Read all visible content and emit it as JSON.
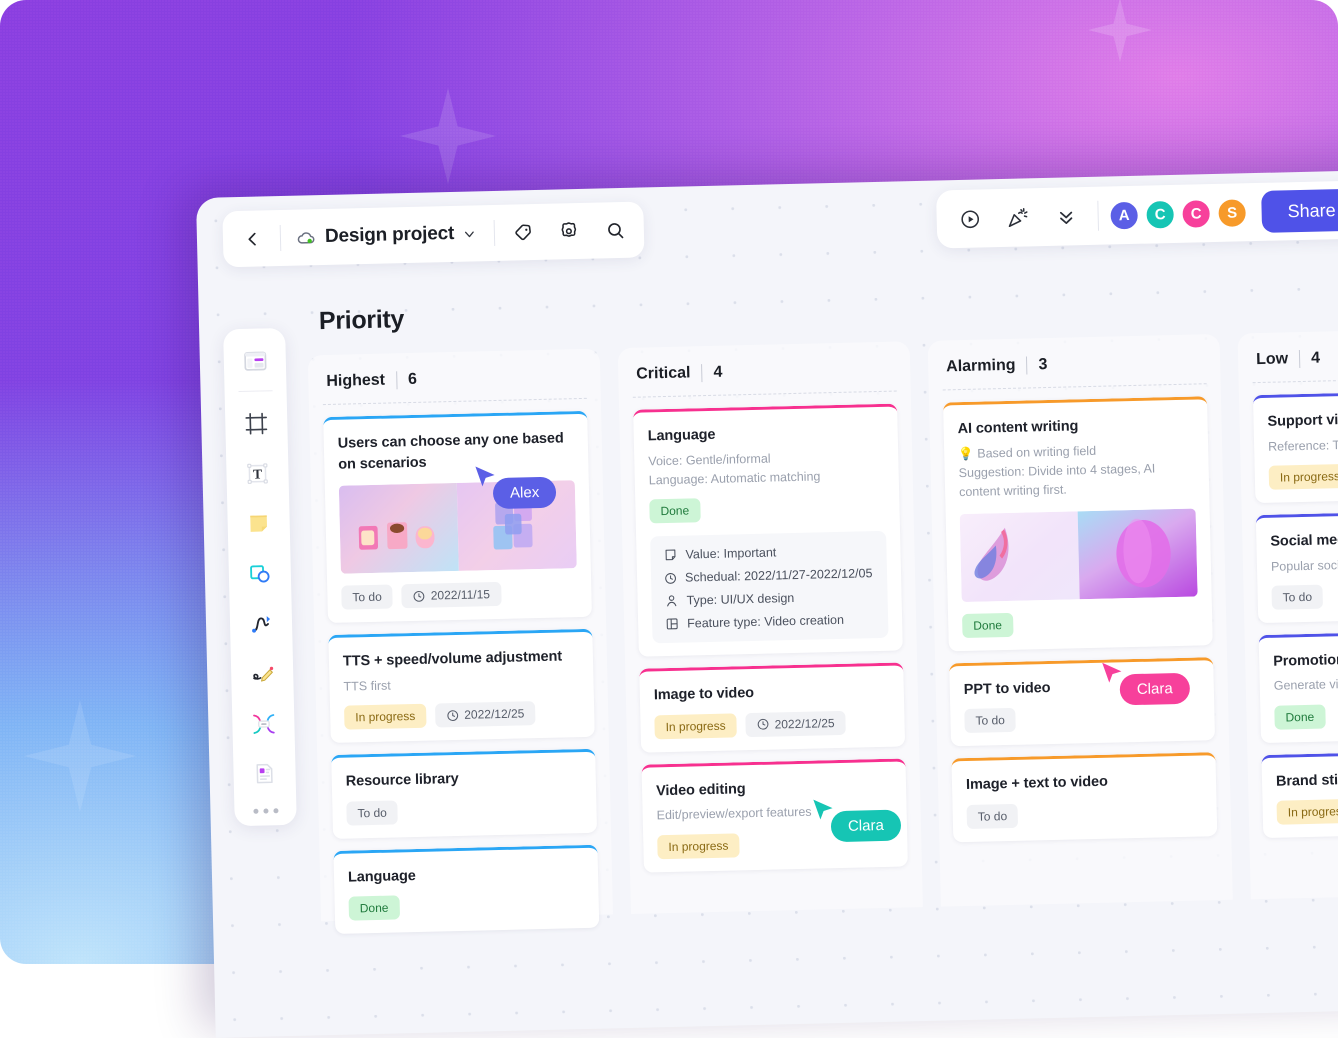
{
  "toolbar": {
    "back_icon": "chevron-left-icon",
    "project_icon": "cloud-status-icon",
    "project_name": "Design project",
    "dropdown_icon": "chevron-down-icon",
    "tag_icon": "tag-icon",
    "settings_icon": "gear-icon",
    "search_icon": "search-icon",
    "present_icon": "play-circle-icon",
    "celebrate_icon": "party-popper-icon",
    "collapse_icon": "double-chevron-down-icon",
    "share_label": "Share",
    "share_color": "#4f52e8",
    "avatars": [
      {
        "initial": "A",
        "color": "#5b5fe6"
      },
      {
        "initial": "C",
        "color": "#16c5b4"
      },
      {
        "initial": "C",
        "color": "#f7409b"
      },
      {
        "initial": "S",
        "color": "#f79a2a"
      }
    ]
  },
  "tool_rail": {
    "items": [
      {
        "icon": "template-frame-icon"
      },
      {
        "icon": "crop-frame-icon"
      },
      {
        "icon": "text-tool-icon"
      },
      {
        "icon": "sticky-note-icon"
      },
      {
        "icon": "shapes-icon"
      },
      {
        "icon": "pen-curve-icon"
      },
      {
        "icon": "pencil-draw-icon"
      },
      {
        "icon": "connector-icon"
      },
      {
        "icon": "document-icon"
      }
    ],
    "more_icon": "more-dots-icon"
  },
  "board": {
    "title": "Priority",
    "columns": [
      {
        "name": "Highest",
        "count": "6",
        "accent": "#2aa6f5",
        "cards": [
          {
            "title": "Users can choose any one based on scenarios",
            "thumb": "product-render-thumb",
            "chips": [
              {
                "label": "To do",
                "style": "todo"
              },
              {
                "label": "2022/11/15",
                "style": "date",
                "icon": "clock-icon"
              }
            ]
          },
          {
            "title": "TTS + speed/volume adjustment",
            "subtitle": "TTS first",
            "chips": [
              {
                "label": "In progress",
                "style": "prog"
              },
              {
                "label": "2022/12/25",
                "style": "date",
                "icon": "clock-icon"
              }
            ]
          },
          {
            "title": "Resource library",
            "chips": [
              {
                "label": "To do",
                "style": "todo"
              }
            ]
          },
          {
            "title": "Language",
            "chips": [
              {
                "label": "Done",
                "style": "done"
              }
            ]
          }
        ]
      },
      {
        "name": "Critical",
        "count": "4",
        "accent": "#f7308f",
        "cards": [
          {
            "title": "Language",
            "subtitle": "Voice: Gentle/informal\nLanguage: Automatic matching",
            "chips": [
              {
                "label": "Done",
                "style": "done"
              }
            ],
            "meta": [
              {
                "icon": "note-icon",
                "text": "Value: Important"
              },
              {
                "icon": "clock-icon",
                "text": "Schedual: 2022/11/27-2022/12/05"
              },
              {
                "icon": "person-icon",
                "text": "Type: UI/UX design"
              },
              {
                "icon": "layout-icon",
                "text": "Feature type: Video creation"
              }
            ]
          },
          {
            "title": "Image to video",
            "chips": [
              {
                "label": "In progress",
                "style": "prog"
              },
              {
                "label": "2022/12/25",
                "style": "date",
                "icon": "clock-icon"
              }
            ]
          },
          {
            "title": "Video editing",
            "subtitle": "Edit/preview/export features",
            "chips": [
              {
                "label": "In progress",
                "style": "prog"
              }
            ]
          }
        ]
      },
      {
        "name": "Alarming",
        "count": "3",
        "accent": "#f79a2a",
        "cards": [
          {
            "title": "AI content writing",
            "subtitle": "💡 Based on writing field\nSuggestion: Divide into 4 stages, AI content writing first.",
            "thumb": "abstract-gradient-thumb",
            "chips": [
              {
                "label": "Done",
                "style": "done"
              }
            ]
          },
          {
            "title": "PPT to video",
            "chips": [
              {
                "label": "To do",
                "style": "todo"
              }
            ]
          },
          {
            "title": "Image + text to video",
            "chips": [
              {
                "label": "To do",
                "style": "todo"
              }
            ]
          }
        ]
      },
      {
        "name": "Low",
        "count": "4",
        "accent": "#4f52e8",
        "cards": [
          {
            "title": "Support video third party platform",
            "subtitle": "Reference: T",
            "chips": [
              {
                "label": "In progress",
                "style": "prog"
              }
            ]
          },
          {
            "title": "Social media",
            "subtitle": "Popular social",
            "chips": [
              {
                "label": "To do",
                "style": "todo"
              }
            ]
          },
          {
            "title": "Promotion",
            "subtitle": "Generate vid",
            "chips": [
              {
                "label": "Done",
                "style": "done"
              }
            ]
          },
          {
            "title": "Brand sticker",
            "chips": [
              {
                "label": "In progress",
                "style": "prog"
              }
            ]
          }
        ]
      }
    ]
  },
  "cursors": [
    {
      "name": "Alex",
      "color": "#5b5fe6"
    },
    {
      "name": "Clara",
      "color": "#16c5b4"
    },
    {
      "name": "Clara",
      "color": "#f7409b"
    }
  ]
}
